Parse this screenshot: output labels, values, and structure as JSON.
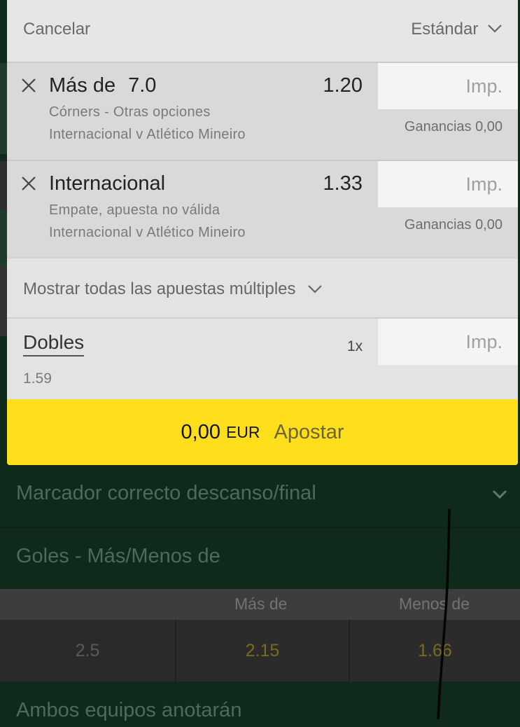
{
  "slip": {
    "cancel_label": "Cancelar",
    "mode_label": "Estándar",
    "bets": [
      {
        "selection": "Más de",
        "handicap": "7.0",
        "odds": "1.20",
        "market": "Córners - Otras opciones",
        "event": "Internacional v Atlético Mineiro",
        "stake_placeholder": "Imp.",
        "returns": "Ganancias 0,00"
      },
      {
        "selection": "Internacional",
        "handicap": "",
        "odds": "1.33",
        "market": "Empate, apuesta no válida",
        "event": "Internacional v Atlético Mineiro",
        "stake_placeholder": "Imp.",
        "returns": "Ganancias 0,00"
      }
    ],
    "show_all_label": "Mostrar todas las apuestas múltiples",
    "doubles": {
      "name": "Dobles",
      "multiplier": "1x",
      "odds": "1.59",
      "stake_placeholder": "Imp."
    },
    "place_bet": {
      "amount": "0,00",
      "currency": "EUR",
      "label": "Apostar"
    }
  },
  "background": {
    "market_1": "Marcador correcto descanso/final",
    "market_2": "Goles - Más/Menos de",
    "table": {
      "headers": [
        "Más de",
        "Menos de"
      ],
      "row": {
        "line": "2.5",
        "over": "2.15",
        "under": "1.66"
      }
    },
    "market_3": "Ambos equipos anotarán"
  },
  "colors": {
    "accent_yellow": "#ffdf1b",
    "background_green": "#0f2a1b"
  }
}
